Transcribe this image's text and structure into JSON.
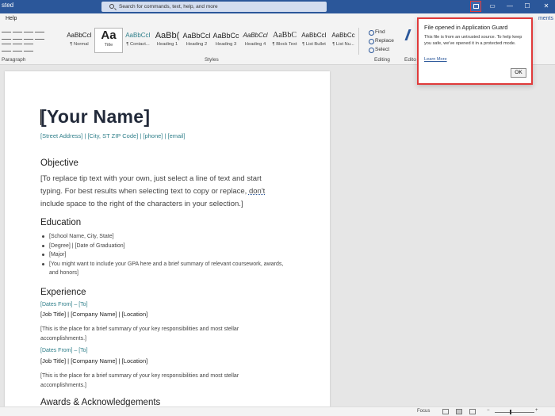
{
  "window": {
    "title_fragment": "sted",
    "search_placeholder": "Search for commands, text, help, and more",
    "controls": {
      "minimize": "—",
      "maximize": "☐",
      "close": "✕"
    }
  },
  "tabs": {
    "help": "Help",
    "comments": "ments"
  },
  "ribbon": {
    "paragraph_label": "Paragraph",
    "styles_label": "Styles",
    "editing_label": "Editing",
    "editor_label": "Edito",
    "styles": [
      {
        "preview": "AaBbCcI",
        "name": "¶ Normal"
      },
      {
        "preview": "Aa",
        "name": "Title"
      },
      {
        "preview": "AaBbCcI",
        "name": "¶ Contact..."
      },
      {
        "preview": "AaBb(",
        "name": "Heading 1"
      },
      {
        "preview": "AaBbCcl",
        "name": "Heading 2"
      },
      {
        "preview": "AaBbCc",
        "name": "Heading 3"
      },
      {
        "preview": "AaBbCcl",
        "name": "Heading 4"
      },
      {
        "preview": "AaBbC",
        "name": "¶ Block Text"
      },
      {
        "preview": "AaBbCcI",
        "name": "¶ List Bullet"
      },
      {
        "preview": "AaBbCc",
        "name": "¶ List Nu..."
      }
    ],
    "editing": {
      "find": "Find",
      "replace": "Replace",
      "select": "Select"
    }
  },
  "document": {
    "name": "[Your Name]",
    "contact": "[Street Address] | [City, ST ZIP Code] | [phone] | [email]",
    "objective_heading": "Objective",
    "objective_text_1": "[To replace tip text with your own, just select a line of text and start typing. For best results when selecting text to copy or replace, ",
    "objective_dont": "don't",
    "objective_text_2": " include space to the right of the characters in your selection.]",
    "education_heading": "Education",
    "education_items": [
      "[School Name, City, State]",
      "[Degree] | [Date of Graduation]",
      "[Major]",
      "[You might want to include your GPA here and a brief summary of relevant coursework, awards, and honors]"
    ],
    "experience_heading": "Experience",
    "experience": [
      {
        "dates": "[Dates From] – [To]",
        "job": "[Job Title] | [Company Name] | [Location]",
        "summary": "[This is the place for a brief summary of your key responsibilities and most stellar accomplishments.]"
      },
      {
        "dates": "[Dates From] – [To]",
        "job": "[Job Title] | [Company Name] | [Location]",
        "summary": "[This is the place for a brief summary of your key responsibilities and most stellar accomplishments.]"
      }
    ],
    "awards_heading": "Awards & Acknowledgements"
  },
  "statusbar": {
    "focus": "Focus"
  },
  "app_guard": {
    "title": "File opened in Application Guard",
    "message": "This file is from an untrusted source. To help keep you safe, we've opened it in a protected mode.",
    "learn_more": "Learn More",
    "ok": "OK"
  },
  "colors": {
    "titlebar": "#2b579a",
    "accent_teal": "#2f7f8a",
    "highlight_red": "#e03a3a"
  }
}
